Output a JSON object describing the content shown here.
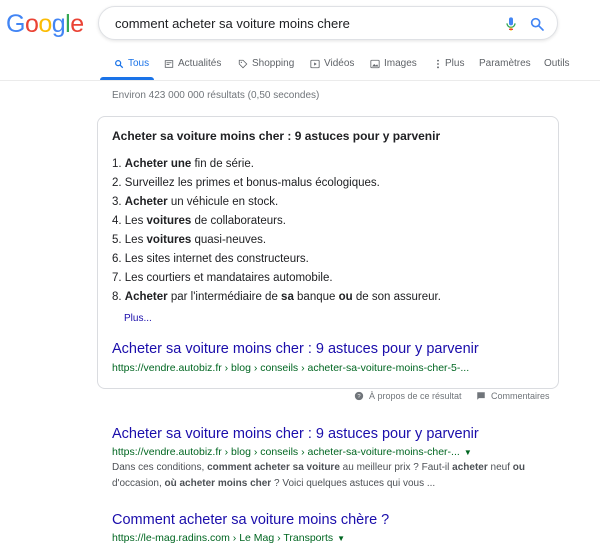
{
  "logo": {
    "letters": [
      "G",
      "o",
      "o",
      "g",
      "l",
      "e"
    ],
    "colors": [
      "#4285f4",
      "#ea4335",
      "#fbbc05",
      "#4285f4",
      "#34a853",
      "#ea4335"
    ]
  },
  "search": {
    "query": "comment acheter sa voiture moins chere",
    "mic_icon": "mic-icon",
    "search_icon": "search-icon"
  },
  "tabs": [
    {
      "label": "Tous",
      "icon": "search-icon",
      "active": true
    },
    {
      "label": "Actualités",
      "icon": "news-icon"
    },
    {
      "label": "Shopping",
      "icon": "tag-icon"
    },
    {
      "label": "Vidéos",
      "icon": "play-icon"
    },
    {
      "label": "Images",
      "icon": "image-icon"
    },
    {
      "label": "Plus",
      "icon": "more-vert-icon"
    },
    {
      "label": "Paramètres"
    },
    {
      "label": "Outils"
    }
  ],
  "stats": "Environ 423 000 000 résultats (0,50 secondes)",
  "snippet": {
    "heading": "Acheter sa voiture moins cher : 9 astuces pour y parvenir",
    "items": [
      [
        [
          "1. ",
          false
        ],
        [
          "Acheter une",
          true
        ],
        [
          " fin de série.",
          false
        ]
      ],
      [
        [
          "2. Surveillez les primes et bonus-malus écologiques.",
          false
        ]
      ],
      [
        [
          "3. ",
          false
        ],
        [
          "Acheter",
          true
        ],
        [
          " un véhicule en stock.",
          false
        ]
      ],
      [
        [
          "4. Les ",
          false
        ],
        [
          "voitures",
          true
        ],
        [
          " de collaborateurs.",
          false
        ]
      ],
      [
        [
          "5. Les ",
          false
        ],
        [
          "voitures",
          true
        ],
        [
          " quasi-neuves.",
          false
        ]
      ],
      [
        [
          "6. Les sites internet des constructeurs.",
          false
        ]
      ],
      [
        [
          "7. Les courtiers et mandataires automobile.",
          false
        ]
      ],
      [
        [
          "8. ",
          false
        ],
        [
          "Acheter",
          true
        ],
        [
          " par l'intermédiaire de ",
          false
        ],
        [
          "sa",
          true
        ],
        [
          " banque ",
          false
        ],
        [
          "ou",
          true
        ],
        [
          " de son assureur.",
          false
        ]
      ]
    ],
    "more_label": "Plus...",
    "title": "Acheter sa voiture moins cher : 9 astuces pour y parvenir",
    "url": "https://vendre.autobiz.fr › blog › conseils › acheter-sa-voiture-moins-cher-5-..."
  },
  "snippet_meta": {
    "about_label": "À propos de ce résultat",
    "feedback_label": "Commentaires"
  },
  "results": [
    {
      "title": "Acheter sa voiture moins cher : 9 astuces pour y parvenir",
      "url": "https://vendre.autobiz.fr › blog › conseils › acheter-sa-voiture-moins-cher-...",
      "desc_line1": [
        [
          "Dans ces conditions, ",
          false
        ],
        [
          "comment acheter sa voiture",
          true
        ],
        [
          " au meilleur prix ? Faut-il ",
          false
        ],
        [
          "acheter",
          true
        ],
        [
          " neuf ",
          false
        ],
        [
          "ou",
          true
        ]
      ],
      "desc_line2": [
        [
          "d'occasion, ",
          false
        ],
        [
          "où acheter moins cher",
          true
        ],
        [
          " ? Voici quelques astuces qui vous ...",
          false
        ]
      ]
    },
    {
      "title": "Comment acheter sa voiture moins chère ?",
      "url": "https://le-mag.radins.com › Le Mag › Transports"
    }
  ]
}
